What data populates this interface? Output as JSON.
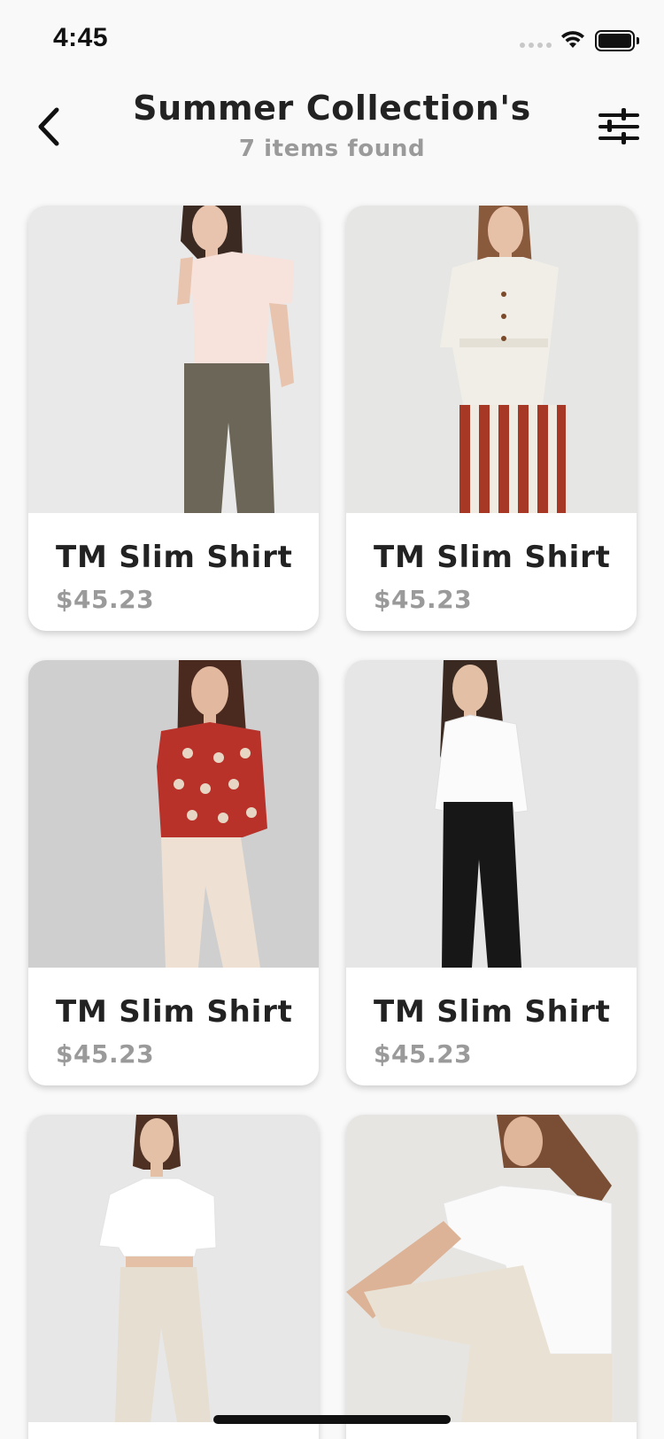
{
  "status_bar": {
    "time": "4:45"
  },
  "header": {
    "title": "Summer Collection's",
    "subtitle": "7 items found"
  },
  "products": [
    {
      "name": "TM Slim Shirt",
      "price": "$45.23"
    },
    {
      "name": "TM Slim Shirt",
      "price": "$45.23"
    },
    {
      "name": "TM Slim Shirt",
      "price": "$45.23"
    },
    {
      "name": "TM Slim Shirt",
      "price": "$45.23"
    },
    {
      "name": "",
      "price": ""
    },
    {
      "name": "",
      "price": ""
    }
  ],
  "icons": {
    "back": "chevron-left-icon",
    "filter": "sliders-icon",
    "wifi": "wifi-icon",
    "battery": "battery-icon"
  },
  "colors": {
    "background": "#f9f9f9",
    "title": "#222222",
    "muted": "#9a9a9a",
    "card": "#ffffff"
  }
}
